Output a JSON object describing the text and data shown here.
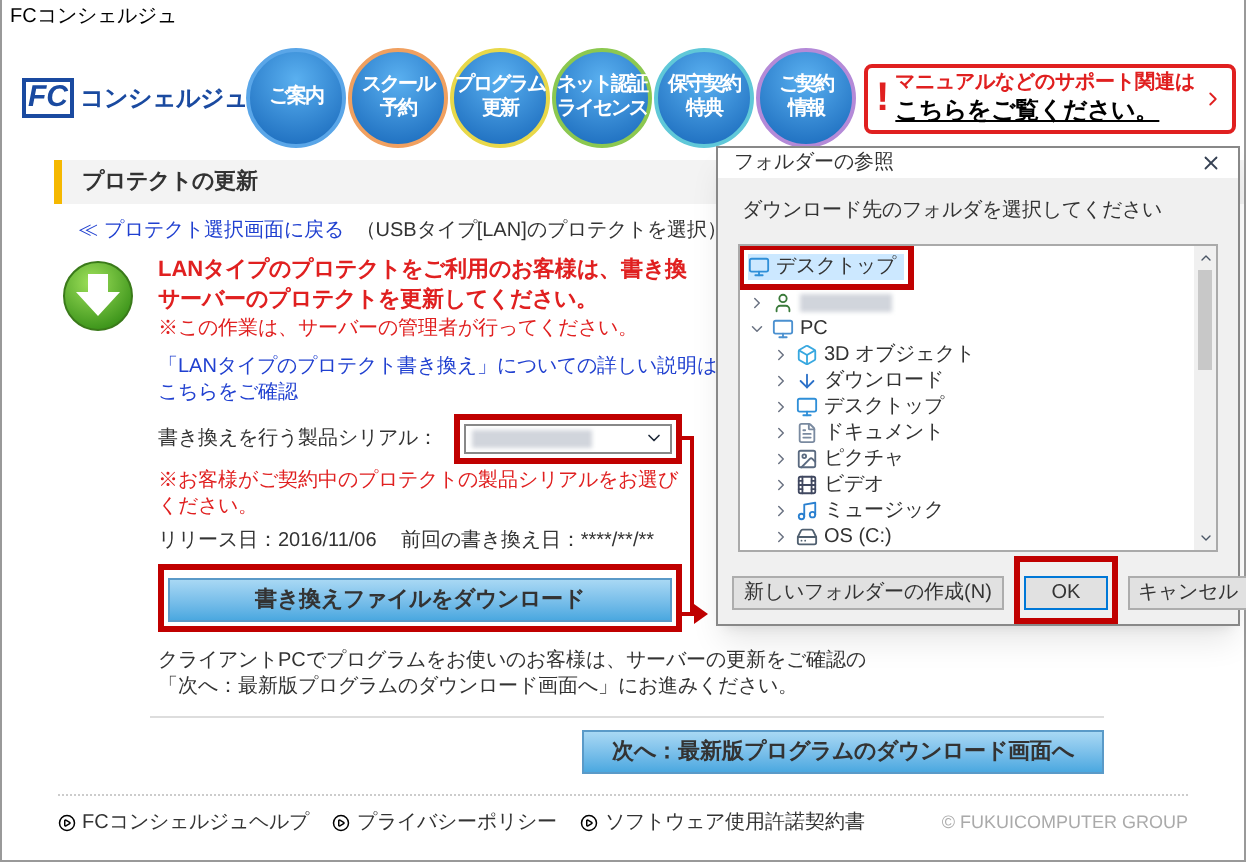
{
  "window": {
    "title": "FCコンシェルジュ"
  },
  "logo": {
    "mark": "FC",
    "text": "コンシェルジュ"
  },
  "nav": [
    {
      "lines": [
        "ご案内"
      ],
      "color": "#5aa6e8"
    },
    {
      "lines": [
        "スクール",
        "予約"
      ],
      "color": "#f0a060"
    },
    {
      "lines": [
        "プログラム",
        "更新"
      ],
      "color": "#e8d84a"
    },
    {
      "lines": [
        "ネット認証",
        "ライセンス"
      ],
      "color": "#8cc850"
    },
    {
      "lines": [
        "保守契約",
        "特典"
      ],
      "color": "#60c8d8"
    },
    {
      "lines": [
        "ご契約",
        "情報"
      ],
      "color": "#b48ad8"
    }
  ],
  "support_banner": {
    "mark": "!",
    "line_1": "マニュアルなどのサポート関連は",
    "line_2": "こちらをご覧ください。"
  },
  "section": {
    "title": "プロテクトの更新"
  },
  "back_link": {
    "label": "≪ プロテクト選択画面に戻る",
    "note": "（USBタイプ[LAN]のプロテクトを選択）"
  },
  "notice": {
    "heading": [
      "LANタイプのプロテクトをご利用のお客様は、書き換",
      "サーバーのプロテクトを更新してください。"
    ],
    "note": "※この作業は、サーバーの管理者が行ってください。"
  },
  "details_link": "「LANタイプのプロテクト書き換え」についての詳しい説明はこちらをご確認",
  "serial": {
    "label": "書き換えを行う製品シリアル：",
    "highlighted": true,
    "warning": "※お客様がご契約中のプロテクトの製品シリアルをお選びください。"
  },
  "release": {
    "date": "リリース日：2016/11/06",
    "last_rewrite": "前回の書き換え日：****/**/**"
  },
  "download_button": {
    "label": "書き換えファイルをダウンロード",
    "highlighted": true
  },
  "client_note": [
    "クライアントPCでプログラムをお使いのお客様は、サーバーの更新をご確認の",
    "「次へ：最新版プログラムのダウンロード画面へ」にお進みください。"
  ],
  "next_button": "次へ：最新版プログラムのダウンロード画面へ",
  "footer": {
    "links": [
      "FCコンシェルジュヘルプ",
      "プライバシーポリシー",
      "ソフトウェア使用許諾契約書"
    ],
    "copyright": "© FUKUICOMPUTER GROUP"
  },
  "dialog": {
    "title": "フォルダーの参照",
    "instruction": "ダウンロード先のフォルダを選択してください",
    "tree": [
      {
        "kind": "desktop",
        "label": "デスクトップ",
        "selected": true,
        "highlighted": true
      },
      {
        "kind": "user",
        "expanded": false,
        "selected": false
      },
      {
        "kind": "pc",
        "label": "PC",
        "expanded": true,
        "selected": false,
        "children": [
          {
            "kind": "objects3d",
            "label": "3D オブジェクト",
            "expanded": false,
            "selected": false
          },
          {
            "kind": "downloads",
            "label": "ダウンロード",
            "expanded": false,
            "selected": false
          },
          {
            "kind": "desktop",
            "label": "デスクトップ",
            "expanded": false,
            "selected": false
          },
          {
            "kind": "documents",
            "label": "ドキュメント",
            "expanded": false,
            "selected": false
          },
          {
            "kind": "pictures",
            "label": "ピクチャ",
            "expanded": false,
            "selected": false
          },
          {
            "kind": "videos",
            "label": "ビデオ",
            "expanded": false,
            "selected": false
          },
          {
            "kind": "music",
            "label": "ミュージック",
            "expanded": false,
            "selected": false
          },
          {
            "kind": "drive",
            "label": "OS (C:)",
            "expanded": false,
            "selected": false
          }
        ]
      }
    ],
    "buttons": [
      {
        "kind": "new_folder",
        "label": "新しいフォルダーの作成(N)",
        "highlighted": false
      },
      {
        "kind": "ok",
        "label": "OK",
        "highlighted": true
      },
      {
        "kind": "cancel",
        "label": "キャンセル",
        "highlighted": false
      }
    ]
  }
}
